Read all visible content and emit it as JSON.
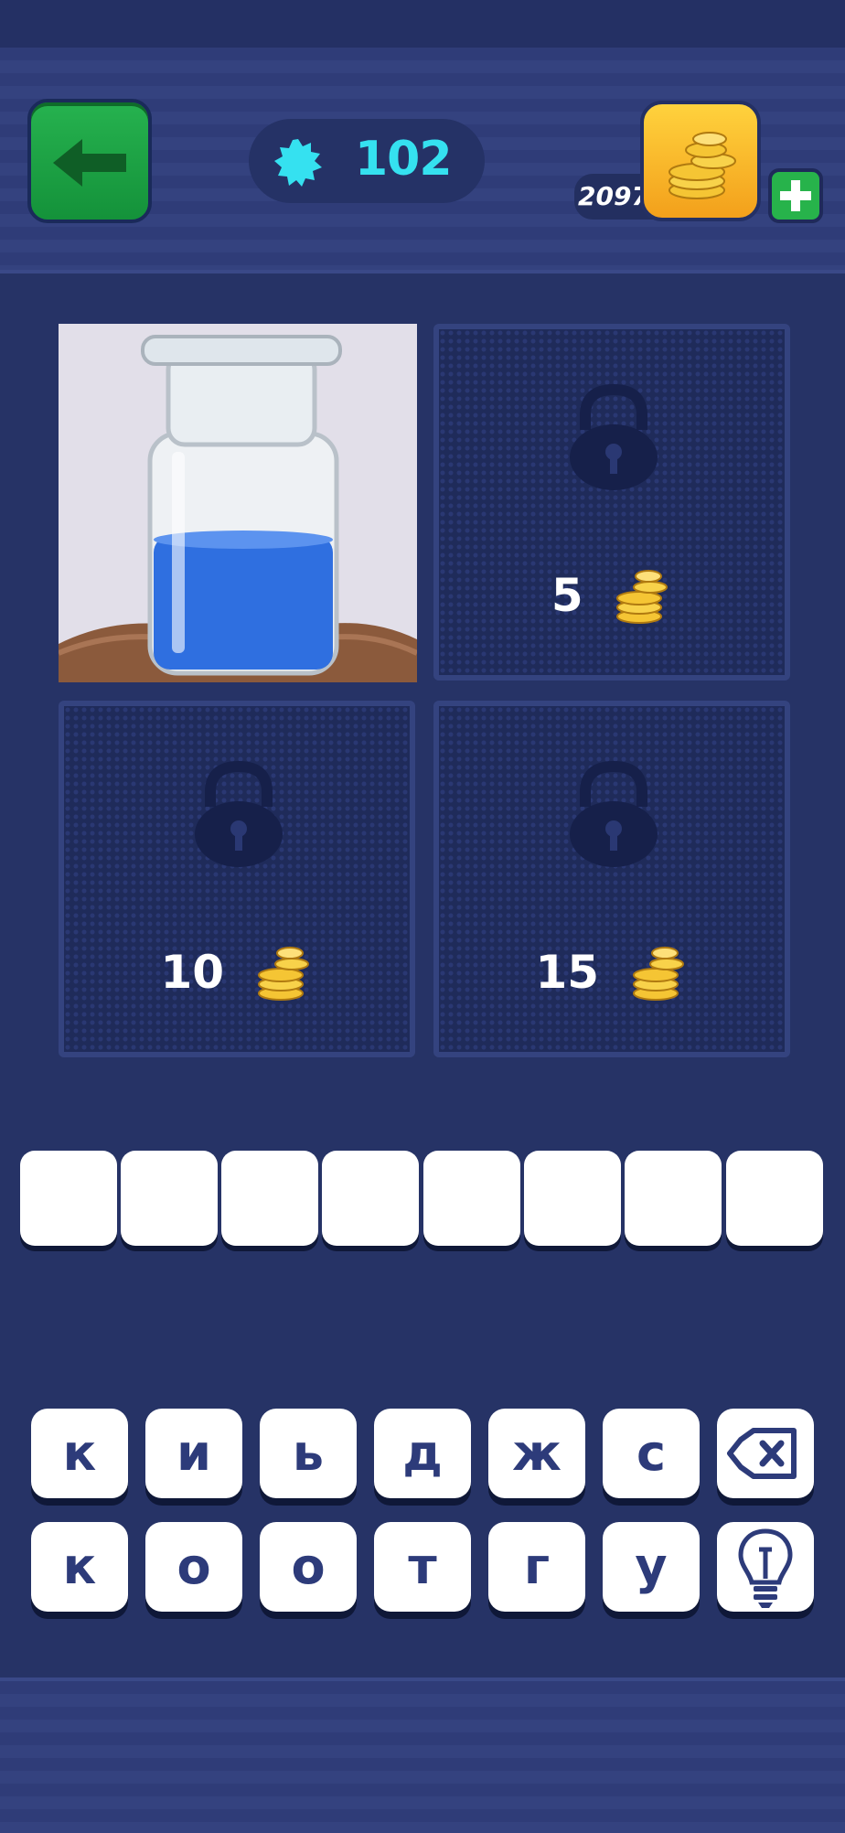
{
  "header": {
    "gems": "102",
    "coins": "2097"
  },
  "tiles": [
    {
      "id": "top-right",
      "cost": "5"
    },
    {
      "id": "bottom-left",
      "cost": "10"
    },
    {
      "id": "bottom-right",
      "cost": "15"
    }
  ],
  "answer": {
    "slot_count": 8,
    "slots": [
      "",
      "",
      "",
      "",
      "",
      "",
      "",
      ""
    ]
  },
  "keyboard": {
    "row1": [
      "к",
      "и",
      "ь",
      "д",
      "ж",
      "с"
    ],
    "row2": [
      "к",
      "о",
      "о",
      "т",
      "г",
      "у"
    ]
  },
  "colors": {
    "background": "#263366",
    "gem": "#35e1f0",
    "back_button": "#1da244",
    "coin_button": "#f7b52a",
    "plus_button": "#27b34b",
    "liquid": "#2f6fe0"
  },
  "icons": {
    "back": "arrow-left-icon",
    "gem": "gem-icon",
    "coins": "coin-stack-icon",
    "plus": "plus-icon",
    "lock": "padlock-icon",
    "delete": "backspace-icon",
    "hint": "lightbulb-icon"
  }
}
